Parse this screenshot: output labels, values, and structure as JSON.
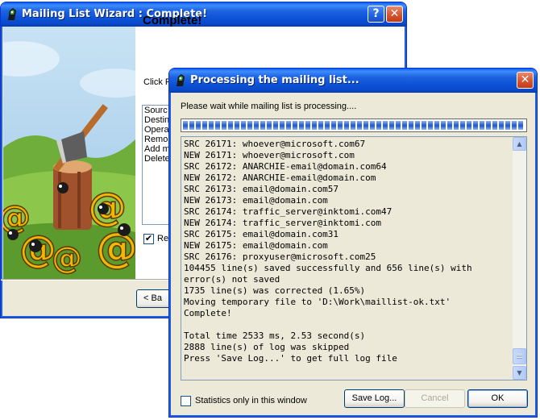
{
  "wizard": {
    "title": "Mailing List Wizard : Complete!",
    "heading": "Complete!",
    "instruction_partial": "Click F",
    "summary_items": [
      "Sourc",
      "Destin",
      "Opera",
      "Remo",
      "Add m",
      "Delete"
    ],
    "checkbox_label_partial": "Re",
    "checkbox_checked": "✔",
    "back_button_partial": "< Ba"
  },
  "processing": {
    "title": "Processing the mailing list...",
    "wait_text": "Please wait while mailing list is processing....",
    "progress_percent": 100,
    "log_lines": [
      "SRC 26171: whoever@microsoft.com67",
      "NEW 26171: whoever@microsoft.com",
      "SRC 26172: ANARCHIE-email@domain.com64",
      "NEW 26172: ANARCHIE-email@domain.com",
      "SRC 26173: email@domain.com57",
      "NEW 26173: email@domain.com",
      "SRC 26174: traffic_server@inktomi.com47",
      "NEW 26174: traffic_server@inktomi.com",
      "SRC 26175: email@domain.com31",
      "NEW 26175: email@domain.com",
      "SRC 26176: proxyuser@microsoft.com25",
      "104455 line(s) saved successfully and 656 line(s) with",
      "error(s) not saved",
      "1735 line(s) was corrected (1.65%)",
      "Moving temporary file to 'D:\\Work\\maillist-ok.txt'",
      "Complete!",
      "",
      "Total time 2533 ms, 2.53 second(s)",
      "2888 line(s) of log was skipped",
      "Press 'Save Log...' to get full log file"
    ],
    "stats_label": "Statistics only in this window",
    "buttons": {
      "save_log": "Save Log...",
      "cancel": "Cancel",
      "ok": "OK"
    }
  },
  "colors": {
    "titlebar_blue": "#0a48c8",
    "close_red": "#d8542e",
    "progress_blue": "#2a5fd6",
    "dialog_face": "#ece9d8"
  }
}
